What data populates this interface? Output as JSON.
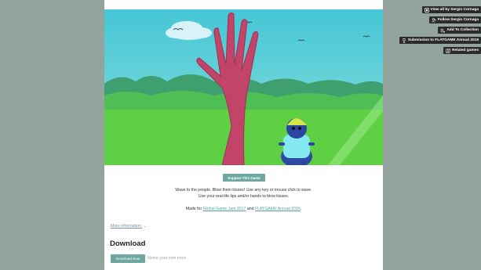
{
  "side_actions": [
    {
      "label": "View all by Sergio Cornaga",
      "icon": "view-all-icon"
    },
    {
      "label": "Follow Sergio Cornaga",
      "icon": "follow-icon"
    },
    {
      "label": "Add To Collection",
      "icon": "collection-icon"
    },
    {
      "label": "Submission to FLATGAME Annual 2016",
      "icon": "trophy-icon"
    },
    {
      "label": "Related games",
      "icon": "related-icon"
    }
  ],
  "support_button": "Support This Game",
  "description": {
    "line1": "Wave to the people. Blow them kisses! Use any key or mouse click to wave.",
    "line2": "Use your real-life lips and/or hands to blow kisses.",
    "made_for_prefix": "Made for ",
    "jam1": "Global Game Jam 2017",
    "and": " and ",
    "jam2": "FLATGAME Annual 2016",
    "suffix": "."
  },
  "more_info": "More information",
  "more_info_chevron": "⌄",
  "download": {
    "title": "Download",
    "button": "Download Now",
    "price_note": "Name your own price"
  },
  "colors": {
    "page_bg": "#93a39e",
    "accent": "#6ea79f",
    "sky": "#4ec9da",
    "grass": "#5fcf45",
    "hand": "#c24468",
    "creature": "#2e4aa3"
  }
}
